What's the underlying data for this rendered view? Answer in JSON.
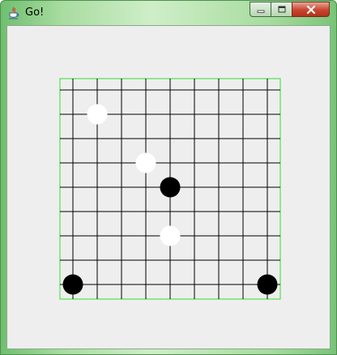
{
  "window": {
    "title": "Go!",
    "app_icon": "java-cup-icon",
    "controls": [
      "minimize-icon",
      "maximize-icon",
      "close-icon"
    ],
    "close_color": "#c8452f"
  },
  "board": {
    "lines": 10,
    "grid_color": "#000000",
    "border_color": "#33dd33",
    "background": "#eeeeee",
    "stones": [
      {
        "color": "white",
        "col": 1,
        "row": 1
      },
      {
        "color": "white",
        "col": 3,
        "row": 3
      },
      {
        "color": "black",
        "col": 4,
        "row": 4
      },
      {
        "color": "white",
        "col": 4,
        "row": 6
      },
      {
        "color": "black",
        "col": 0,
        "row": 8
      },
      {
        "color": "black",
        "col": 8,
        "row": 8
      }
    ]
  }
}
